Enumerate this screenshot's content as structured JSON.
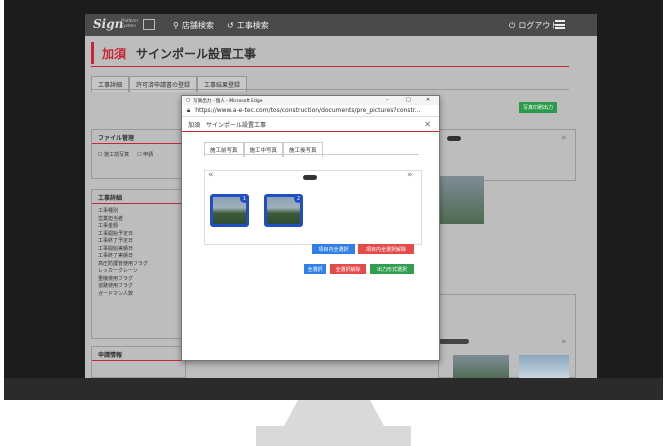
{
  "nav": {
    "logo": "Sign",
    "logo_sub": "Platform System",
    "search_store": "店舗検索",
    "search_construction": "工事検索",
    "logout": "ログアウト"
  },
  "page": {
    "title_prefix": "加須",
    "title": "サインポール設置工事",
    "tabs": [
      "工事詳細",
      "許可済申請書の登録",
      "工事結果登録"
    ],
    "export_button": "写真印刷出力"
  },
  "file_panel": {
    "title": "ファイル管理",
    "checkbox1": "施工前写真",
    "checkbox2": "申請"
  },
  "detail_panel": {
    "title": "工事詳細",
    "items": [
      "工事種別",
      "営業担当者",
      "工事金額",
      "工事開始予定日",
      "工事終了予定日",
      "工事開始実績日",
      "工事終了実績日",
      "高圧防護管使用フラグ",
      "レッカークレーン",
      "重機使用フラグ",
      "道路使用フラグ",
      "ガードマン人数"
    ]
  },
  "apply_panel": {
    "title": "申請情報"
  },
  "popup": {
    "window_title": "写真出力 - 個人 - Microsoft Edge",
    "url": "https://www.a-e-tec.com/tos/construction/documents/pre_pictures?constr...",
    "header_prefix": "加須",
    "header_title": "サインポール設置工事",
    "tabs": [
      "施工前写真",
      "施工中写真",
      "施工後写真"
    ],
    "photos": [
      {
        "badge": "1"
      },
      {
        "badge": "2"
      }
    ],
    "buttons": {
      "select_in_item": "項目内全選択",
      "deselect_in_item": "項目内全選択解除",
      "select_all": "全選択",
      "deselect_all": "全選択解除",
      "output_select": "出力形式選択"
    }
  },
  "colors": {
    "accent": "#c62833",
    "primary": "#2f7fe6",
    "danger": "#e34b4b",
    "success": "#2f9e4f"
  }
}
